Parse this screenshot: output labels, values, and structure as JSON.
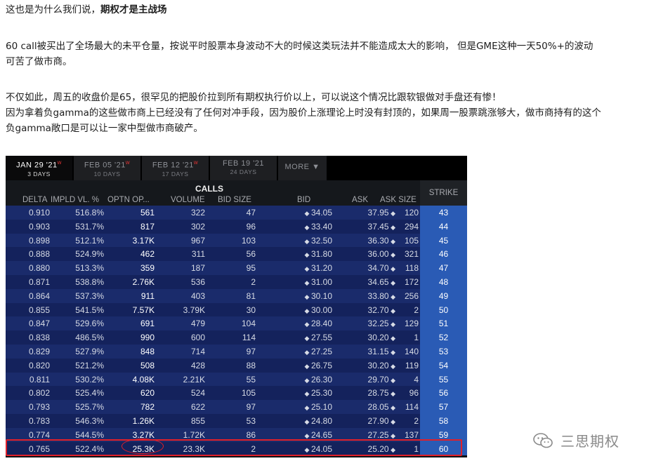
{
  "article": {
    "p1_normal": "这也是为什么我们说，",
    "p1_bold": "期权才是主战场",
    "p2_line1": "60 call被买出了全场最大的未平仓量，按说平时股票本身波动不大的时候这类玩法并不能造成太大的影响， 但是GME这种一天50%+的波动",
    "p2_line2": "可苦了做市商。",
    "p3_line1": "不仅如此，周五的收盘价是65，很罕见的把股价拉到所有期权执行价以上，可以说这个情况比跟软银做对手盘还有惨！",
    "p3_line2": "因为拿着负gamma的这些做市商上已经没有了任何对冲手段，因为股价上涨理论上时没有封顶的，如果周一股票跳涨够大，做市商持有的这个",
    "p3_line3": "负gamma敞口是可以让一家中型做市商破产。"
  },
  "tabs": [
    {
      "date": "JAN 29 '21",
      "days": "3 DAYS",
      "active": true
    },
    {
      "date": "FEB 05 '21",
      "days": "10 DAYS",
      "active": false
    },
    {
      "date": "FEB 12 '21",
      "days": "17 DAYS",
      "active": false
    },
    {
      "date": "FEB 19 '21",
      "days": "24 DAYS",
      "active": false
    }
  ],
  "more_label": "MORE ▼",
  "table": {
    "section_title": "CALLS",
    "headers": {
      "delta": "DELTA",
      "impl_vol": "IMPLD VL. %",
      "open_int": "OPTN OP...",
      "volume": "VOLUME",
      "bid_size": "BID SIZE",
      "bid": "BID",
      "ask": "ASK",
      "ask_size": "ASK SIZE",
      "strike": "STRIKE"
    },
    "rows": [
      {
        "delta": "0.910",
        "iv": "516.8%",
        "oi": "561",
        "vol": "322",
        "bs": "47",
        "bid": "34.05",
        "ask": "37.95",
        "as": "120",
        "strike": "43"
      },
      {
        "delta": "0.903",
        "iv": "531.7%",
        "oi": "817",
        "vol": "302",
        "bs": "96",
        "bid": "33.40",
        "ask": "37.45",
        "as": "294",
        "strike": "44"
      },
      {
        "delta": "0.898",
        "iv": "512.1%",
        "oi": "3.17K",
        "vol": "967",
        "bs": "103",
        "bid": "32.50",
        "ask": "36.30",
        "as": "105",
        "strike": "45"
      },
      {
        "delta": "0.888",
        "iv": "524.9%",
        "oi": "462",
        "vol": "311",
        "bs": "56",
        "bid": "31.80",
        "ask": "36.00",
        "as": "321",
        "strike": "46"
      },
      {
        "delta": "0.880",
        "iv": "513.3%",
        "oi": "359",
        "vol": "187",
        "bs": "95",
        "bid": "31.20",
        "ask": "34.70",
        "as": "118",
        "strike": "47"
      },
      {
        "delta": "0.871",
        "iv": "538.8%",
        "oi": "2.76K",
        "vol": "536",
        "bs": "2",
        "bid": "31.00",
        "ask": "34.65",
        "as": "172",
        "strike": "48"
      },
      {
        "delta": "0.864",
        "iv": "537.3%",
        "oi": "911",
        "vol": "403",
        "bs": "81",
        "bid": "30.10",
        "ask": "33.80",
        "as": "256",
        "strike": "49"
      },
      {
        "delta": "0.855",
        "iv": "541.5%",
        "oi": "7.57K",
        "vol": "3.79K",
        "bs": "30",
        "bid": "30.00",
        "ask": "32.70",
        "as": "2",
        "strike": "50"
      },
      {
        "delta": "0.847",
        "iv": "529.6%",
        "oi": "691",
        "vol": "479",
        "bs": "104",
        "bid": "28.40",
        "ask": "32.25",
        "as": "129",
        "strike": "51"
      },
      {
        "delta": "0.838",
        "iv": "486.5%",
        "oi": "990",
        "vol": "600",
        "bs": "114",
        "bid": "27.55",
        "ask": "30.20",
        "as": "1",
        "strike": "52"
      },
      {
        "delta": "0.829",
        "iv": "527.9%",
        "oi": "848",
        "vol": "714",
        "bs": "97",
        "bid": "27.25",
        "ask": "31.15",
        "as": "140",
        "strike": "53"
      },
      {
        "delta": "0.820",
        "iv": "521.2%",
        "oi": "508",
        "vol": "428",
        "bs": "88",
        "bid": "26.75",
        "ask": "30.20",
        "as": "119",
        "strike": "54"
      },
      {
        "delta": "0.811",
        "iv": "530.2%",
        "oi": "4.08K",
        "vol": "2.21K",
        "bs": "55",
        "bid": "26.30",
        "ask": "29.70",
        "as": "4",
        "strike": "55"
      },
      {
        "delta": "0.802",
        "iv": "525.4%",
        "oi": "620",
        "vol": "524",
        "bs": "105",
        "bid": "25.30",
        "ask": "28.75",
        "as": "96",
        "strike": "56"
      },
      {
        "delta": "0.793",
        "iv": "525.7%",
        "oi": "782",
        "vol": "622",
        "bs": "97",
        "bid": "25.10",
        "ask": "28.05",
        "as": "114",
        "strike": "57"
      },
      {
        "delta": "0.783",
        "iv": "546.3%",
        "oi": "1.26K",
        "vol": "855",
        "bs": "53",
        "bid": "24.80",
        "ask": "27.90",
        "as": "2",
        "strike": "58"
      },
      {
        "delta": "0.774",
        "iv": "544.5%",
        "oi": "3.27K",
        "vol": "1.72K",
        "bs": "86",
        "bid": "24.65",
        "ask": "27.25",
        "as": "137",
        "strike": "59"
      },
      {
        "delta": "0.765",
        "iv": "522.4%",
        "oi": "25.3K",
        "vol": "23.3K",
        "bs": "2",
        "bid": "24.05",
        "ask": "25.20",
        "as": "1",
        "strike": "60"
      }
    ]
  },
  "watermark": {
    "text": "三思期权",
    "icon": "wechat-icon"
  },
  "colors": {
    "highlight": "#e0202a",
    "strike_col": "#2a5bb5",
    "row_bg": "#1a2b6b"
  }
}
